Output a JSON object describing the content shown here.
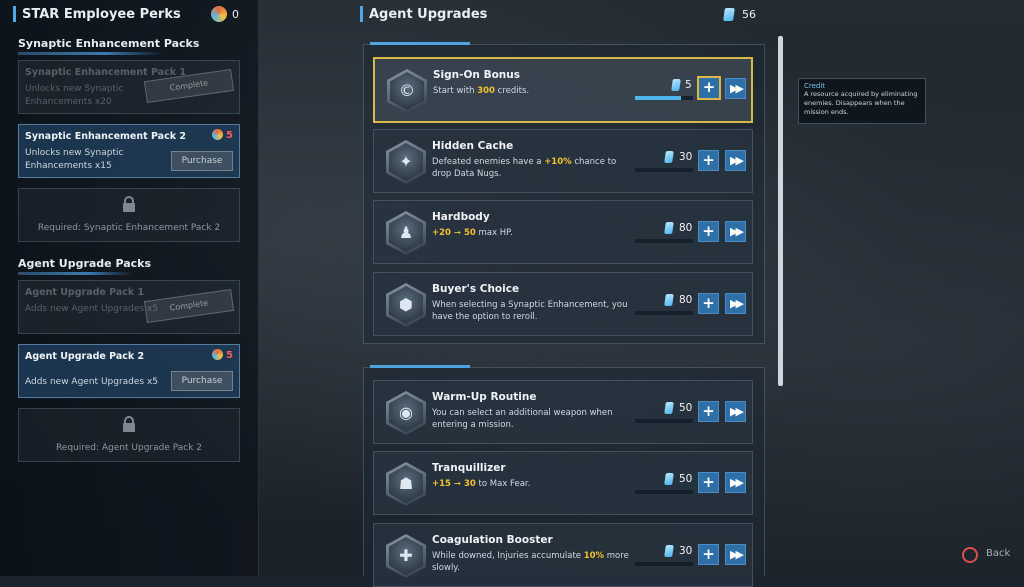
{
  "left": {
    "title": "STAR Employee Perks",
    "perk_count": "0",
    "synaptic_heading": "Synaptic Enhancement Packs",
    "synaptic_packs": [
      {
        "title": "Synaptic Enhancement Pack 1",
        "desc": "Unlocks new Synaptic Enhancements x20",
        "stamp": "Complete"
      },
      {
        "title": "Synaptic Enhancement Pack 2",
        "desc": "Unlocks new Synaptic Enhancements x15",
        "cost": "5",
        "button": "Purchase"
      },
      {
        "locked_text": "Required: Synaptic Enhancement Pack 2"
      }
    ],
    "agent_heading": "Agent Upgrade Packs",
    "agent_packs": [
      {
        "title": "Agent Upgrade Pack 1",
        "desc": "Adds new Agent Upgrades x5",
        "stamp": "Complete"
      },
      {
        "title": "Agent Upgrade Pack 2",
        "desc": "Adds new Agent Upgrades x5",
        "cost": "5",
        "button": "Purchase"
      },
      {
        "locked_text": "Required: Agent Upgrade Pack 2"
      }
    ]
  },
  "center": {
    "title": "Agent Upgrades",
    "currency": "56",
    "upgrades": [
      {
        "title": "Sign-On Bonus",
        "desc_pre": "Start with ",
        "desc_hl": "300",
        "desc_post": " credits.",
        "price": "5",
        "progress": 0.8,
        "glyph": "©"
      },
      {
        "title": "Hidden Cache",
        "desc_pre": "Defeated enemies have a ",
        "desc_hl": "+10%",
        "desc_post": " chance to drop Data Nugs.",
        "price": "30",
        "progress": 0,
        "glyph": "✦"
      },
      {
        "title": "Hardbody",
        "desc_pre": "",
        "desc_hl": "+20 ➞ 50",
        "desc_post": " max HP.",
        "price": "80",
        "progress": 0,
        "glyph": "♟"
      },
      {
        "title": "Buyer's Choice",
        "desc_pre": "When selecting a Synaptic Enhancement, you have the option to reroll.",
        "desc_hl": "",
        "desc_post": "",
        "price": "80",
        "progress": 0,
        "glyph": "⬢"
      },
      {
        "title": "Warm-Up Routine",
        "desc_pre": "You can select an additional weapon when entering a mission.",
        "desc_hl": "",
        "desc_post": "",
        "price": "50",
        "progress": 0,
        "glyph": "◉"
      },
      {
        "title": "Tranquillizer",
        "desc_pre": "",
        "desc_hl": "+15 ➞ 30",
        "desc_post": " to Max Fear.",
        "price": "50",
        "progress": 0,
        "glyph": "☗"
      },
      {
        "title": "Coagulation Booster",
        "desc_pre": "While downed, Injuries accumulate ",
        "desc_hl": "10%",
        "desc_post": " more slowly.",
        "price": "30",
        "progress": 0,
        "glyph": "✚"
      }
    ]
  },
  "tooltip": {
    "title": "Credit",
    "body": "A resource acquired by eliminating enemies. Disappears when the mission ends."
  },
  "footer": {
    "back_label": "Back"
  },
  "icons": {
    "plus": "+",
    "fast_forward": "▶▶"
  }
}
